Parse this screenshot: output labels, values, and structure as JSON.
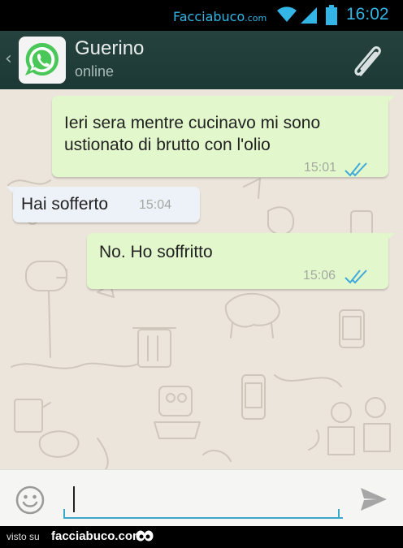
{
  "status_bar": {
    "brand": "Facciabuco",
    "brand_suffix": ".com",
    "time": "16:02",
    "accent_color": "#33b5e5"
  },
  "header": {
    "contact_name": "Guerino",
    "contact_status": "online",
    "avatar_icon": "whatsapp-logo-icon",
    "attach_icon": "paperclip-icon",
    "back_icon": "chevron-left-icon",
    "bar_color": "#1f3f3b"
  },
  "messages": [
    {
      "direction": "outgoing",
      "text": "Ieri sera mentre cucinavo mi sono ustionato di brutto con l'olio",
      "time": "15:01",
      "status_icon": "double-check-icon"
    },
    {
      "direction": "incoming",
      "text": "Hai sofferto",
      "time": "15:04"
    },
    {
      "direction": "outgoing",
      "text": "No. Ho soffritto",
      "time": "15:06",
      "status_icon": "double-check-icon"
    }
  ],
  "composer": {
    "value": "",
    "emoji_icon": "smiley-icon",
    "send_icon": "send-icon"
  },
  "footer": {
    "visto_su": "visto su",
    "brand": "facciabuco.com"
  },
  "colors": {
    "outgoing_bubble": "#e2f7cb",
    "incoming_bubble": "#edf1f8",
    "read_ticks": "#3fa9dc",
    "chat_background": "#ece5dc"
  }
}
